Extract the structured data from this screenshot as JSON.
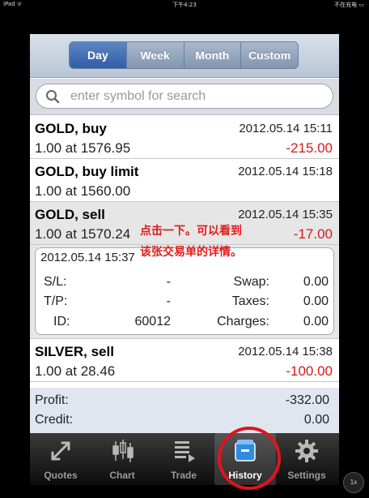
{
  "status_bar": {
    "device": "iPad ᯤ",
    "time": "下午4:23",
    "battery": "不在充电 ▭"
  },
  "segments": [
    {
      "label": "Day",
      "active": true
    },
    {
      "label": "Week",
      "active": false
    },
    {
      "label": "Month",
      "active": false
    },
    {
      "label": "Custom",
      "active": false
    }
  ],
  "search": {
    "placeholder": "enter symbol for search"
  },
  "trades": [
    {
      "symbol": "GOLD, buy",
      "time": "2012.05.14 15:11",
      "volume": "1.00 at 1576.95",
      "profit": "-215.00"
    },
    {
      "symbol": "GOLD, buy limit",
      "time": "2012.05.14 15:18",
      "volume": "1.00 at 1560.00",
      "profit": ""
    },
    {
      "symbol": "GOLD, sell",
      "time": "2012.05.14 15:35",
      "volume": "1.00 at 1570.24",
      "profit": "-17.00"
    },
    {
      "symbol": "SILVER, sell",
      "time": "2012.05.14 15:38",
      "volume": "1.00 at 28.46",
      "profit": "-100.00"
    }
  ],
  "detail": {
    "datetime": "2012.05.14 15:37",
    "sl_label": "S/L:",
    "sl_value": "-",
    "tp_label": "T/P:",
    "tp_value": "-",
    "id_label": "ID:",
    "id_value": "60012",
    "swap_label": "Swap:",
    "swap_value": "0.00",
    "taxes_label": "Taxes:",
    "taxes_value": "0.00",
    "charges_label": "Charges:",
    "charges_value": "0.00"
  },
  "summary": {
    "profit_label": "Profit:",
    "profit_value": "-332.00",
    "credit_label": "Credit:",
    "credit_value": "0.00"
  },
  "tabs": [
    {
      "label": "Quotes",
      "icon": "quotes-arrows-icon"
    },
    {
      "label": "Chart",
      "icon": "candlestick-chart-icon"
    },
    {
      "label": "Trade",
      "icon": "trade-list-icon"
    },
    {
      "label": "History",
      "icon": "history-box-icon",
      "active": true
    },
    {
      "label": "Settings",
      "icon": "gear-icon"
    }
  ],
  "annotation": {
    "line1": "点击一下。可以看到",
    "line2": "该张交易单的详情。"
  },
  "zoom": {
    "label": "1x"
  },
  "colors": {
    "loss": "#d41b1b",
    "annotation": "#e21a1a",
    "segment_active": "#2e5da8"
  }
}
